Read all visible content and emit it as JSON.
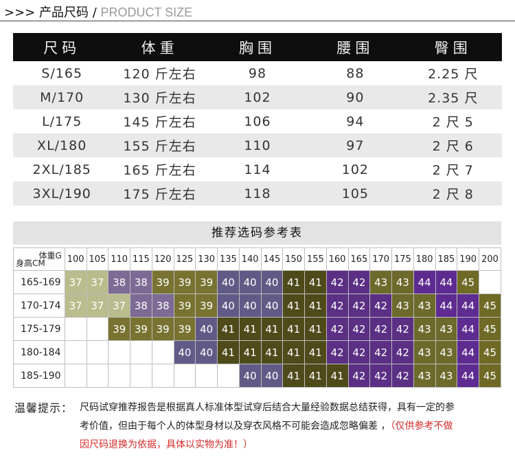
{
  "header": {
    "prefix": ">>> ",
    "title_cn": "产品尺码",
    "separator": " / ",
    "title_en": "PRODUCT SIZE"
  },
  "size_table": {
    "columns": [
      "尺码",
      "体重",
      "胸围",
      "腰围",
      "臀围"
    ],
    "rows": [
      [
        "S/165",
        "120 斤左右",
        "98",
        "88",
        "2.25 尺"
      ],
      [
        "M/170",
        "130 斤左右",
        "102",
        "90",
        "2.35 尺"
      ],
      [
        "L/175",
        "145 斤左右",
        "106",
        "94",
        "2 尺 5"
      ],
      [
        "XL/180",
        "155 斤左右",
        "110",
        "97",
        "2 尺 6"
      ],
      [
        "2XL/185",
        "165 斤左右",
        "114",
        "102",
        "2 尺 7"
      ],
      [
        "3XL/190",
        "175 斤左右",
        "118",
        "105",
        "2 尺 8"
      ]
    ]
  },
  "reference": {
    "title": "推荐选码参考表",
    "corner_weight": "体重G",
    "corner_height": "身高CM",
    "weights": [
      "100",
      "105",
      "110",
      "115",
      "120",
      "125",
      "130",
      "135",
      "140",
      "145",
      "150",
      "155",
      "160",
      "165",
      "170",
      "175",
      "180",
      "185",
      "190",
      "200"
    ],
    "heights": [
      "165-169",
      "170-174",
      "175-179",
      "180-184",
      "185-190"
    ],
    "grid": [
      [
        "37",
        "37",
        "38",
        "38",
        "39",
        "39",
        "39",
        "40",
        "40",
        "40",
        "41",
        "41",
        "42",
        "42",
        "43",
        "43",
        "44",
        "44",
        "45",
        ""
      ],
      [
        "37",
        "37",
        "37",
        "38",
        "38",
        "39",
        "39",
        "40",
        "40",
        "40",
        "41",
        "41",
        "42",
        "42",
        "42",
        "43",
        "43",
        "44",
        "44",
        "45"
      ],
      [
        "",
        "",
        "39",
        "39",
        "39",
        "39",
        "40",
        "41",
        "41",
        "41",
        "41",
        "41",
        "42",
        "42",
        "42",
        "42",
        "43",
        "43",
        "44",
        "45"
      ],
      [
        "",
        "",
        "",
        "",
        "",
        "40",
        "40",
        "41",
        "41",
        "41",
        "41",
        "41",
        "42",
        "42",
        "42",
        "42",
        "43",
        "43",
        "44",
        "45"
      ],
      [
        "",
        "",
        "",
        "",
        "",
        "",
        "",
        "",
        "40",
        "40",
        "41",
        "41",
        "41",
        "42",
        "42",
        "42",
        "43",
        "43",
        "44",
        "45"
      ]
    ],
    "colors": {
      "37": "#b9bc8c",
      "38": "#7d6a95",
      "39": "#787331",
      "40": "#625a86",
      "41": "#4e4a1a",
      "42": "#5a2f84",
      "43": "#6d6a2c",
      "44": "#5e2b91",
      "45": "#6f6a26"
    }
  },
  "tip": {
    "label": "温馨提示：",
    "line1": "尺码试穿推荐报告是根据真人标准体型试穿后结合大量经验数据总结获得，具有一定的参",
    "line2": "考价值，但由于每个人的体型身材以及穿衣风格不可能会造成忽略偏差 ，",
    "red1": "（仅供参考不做",
    "red2": "因尺码退换为依据，具体以实物为准！）"
  }
}
